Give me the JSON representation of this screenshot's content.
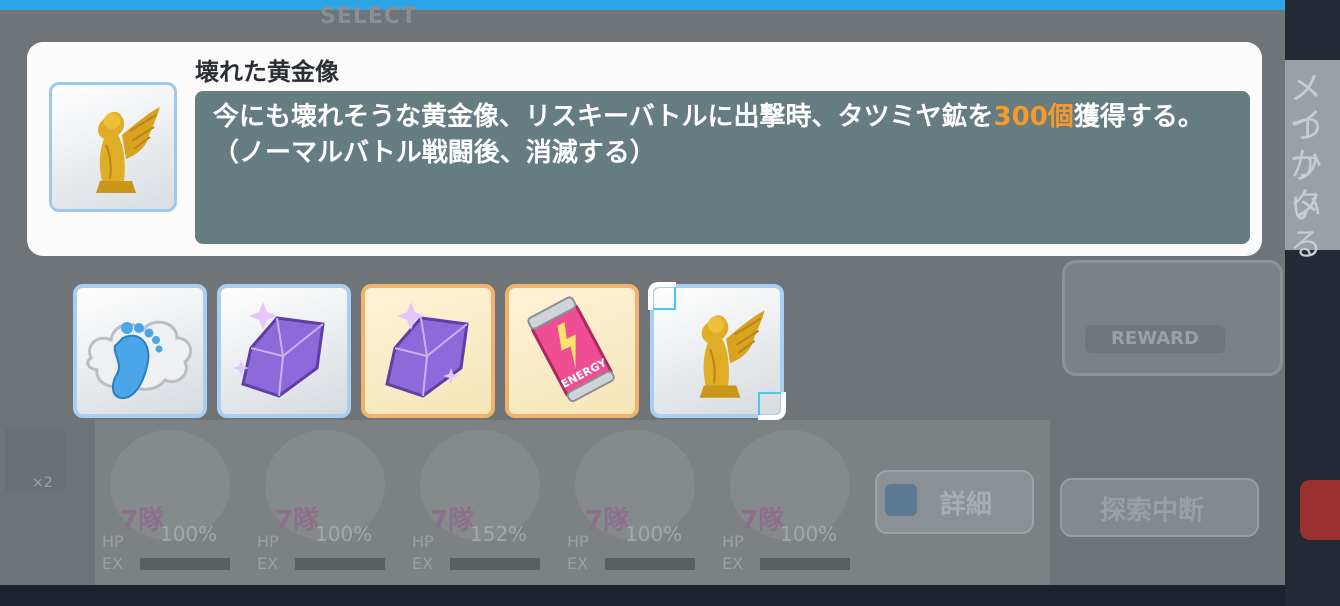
{
  "background": {
    "select_label": "SELECT",
    "reward_label": "REWARD",
    "detail_button_label": "詳細",
    "stop_button_label": "探索中断",
    "left_tile_count": "×2",
    "right_text": [
      "メイ",
      "つか",
      "フタ",
      "いる"
    ],
    "characters": [
      {
        "level": "7隊",
        "hp_label": "HP",
        "ex_label": "EX",
        "hp_percent": "100%"
      },
      {
        "level": "7隊",
        "hp_label": "HP",
        "ex_label": "EX",
        "hp_percent": "100%"
      },
      {
        "level": "7隊",
        "hp_label": "HP",
        "ex_label": "EX",
        "hp_percent": "152%"
      },
      {
        "level": "7隊",
        "hp_label": "HP",
        "ex_label": "EX",
        "hp_percent": "100%"
      },
      {
        "level": "7隊",
        "hp_label": "HP",
        "ex_label": "EX",
        "hp_percent": "100%"
      }
    ]
  },
  "item_info": {
    "title": "壊れた黄金像",
    "description_before": "今にも壊れそうな黄金像、リスキーバトルに出撃時、タツミヤ鉱を",
    "description_highlight": "300個",
    "description_after": "獲得する。（ノーマルバトル戦闘後、消滅する）",
    "highlight_color": "#f79a2c",
    "icon": "golden-statue-icon"
  },
  "items": [
    {
      "icon": "footprint-icon",
      "frame": "blue"
    },
    {
      "icon": "purple-crystal-icon",
      "frame": "blue"
    },
    {
      "icon": "purple-crystal-icon",
      "frame": "gold"
    },
    {
      "icon": "energy-drink-icon",
      "frame": "gold",
      "can_text": "ENERGY"
    },
    {
      "icon": "golden-statue-icon",
      "frame": "blue",
      "selected": true
    }
  ]
}
